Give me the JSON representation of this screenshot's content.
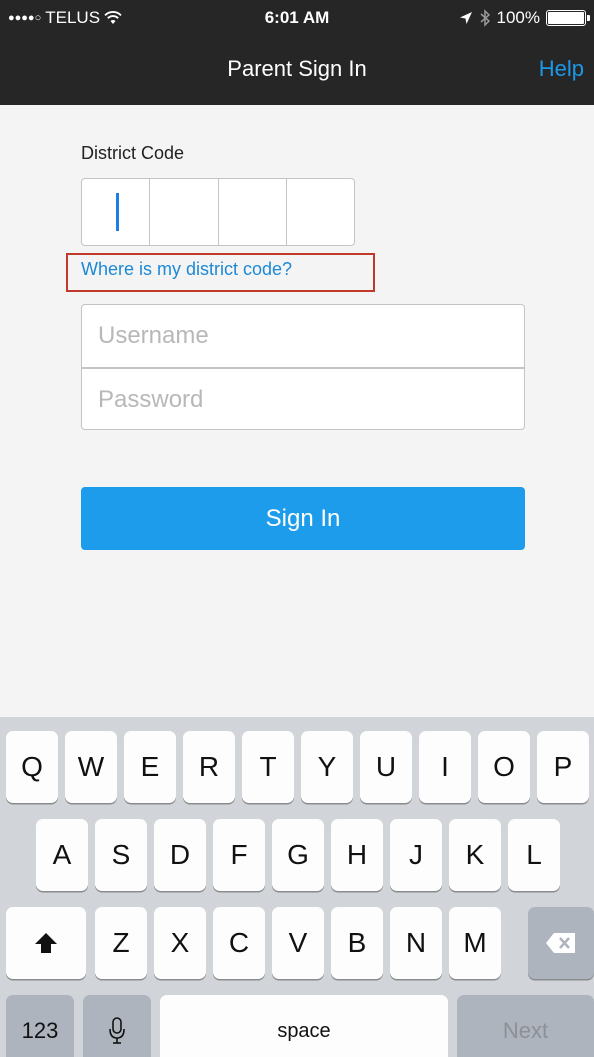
{
  "status_bar": {
    "signal_dots": "●●●●○",
    "carrier": "TELUS",
    "wifi_icon": "wifi-icon",
    "time": "6:01 AM",
    "location_icon": "location-arrow-icon",
    "bluetooth_icon": "bluetooth-icon",
    "battery": "100%",
    "battery_icon": "battery-full-icon"
  },
  "nav": {
    "title": "Parent Sign In",
    "help": "Help"
  },
  "form": {
    "district_code_label": "District Code",
    "district_code_link": "Where is my district code?",
    "username_placeholder": "Username",
    "password_placeholder": "Password",
    "sign_in": "Sign In"
  },
  "keyboard": {
    "row1": [
      "Q",
      "W",
      "E",
      "R",
      "T",
      "Y",
      "U",
      "I",
      "O",
      "P"
    ],
    "row2": [
      "A",
      "S",
      "D",
      "F",
      "G",
      "H",
      "J",
      "K",
      "L"
    ],
    "row3": [
      "Z",
      "X",
      "C",
      "V",
      "B",
      "N",
      "M"
    ],
    "numbers": "123",
    "space": "space",
    "next": "Next",
    "shift_icon": "shift-icon",
    "delete_icon": "delete-icon",
    "mic_icon": "microphone-icon"
  },
  "colors": {
    "accent": "#1e9cec",
    "nav_bg": "#262626",
    "highlight_border": "#c0392b"
  }
}
